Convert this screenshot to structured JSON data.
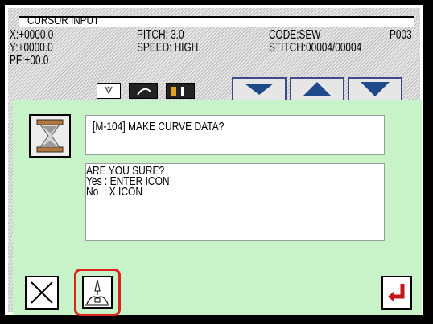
{
  "header": {
    "title": "CURSOR INPUT",
    "x": "X:+0000.0",
    "y": "Y:+0000.0",
    "pf": "PF:+00.0",
    "pitch": "PITCH: 3.0",
    "speed": "SPEED: HIGH",
    "code": "CODE:SEW",
    "pattern": "P003",
    "stitch": "STITCH:00004/00004"
  },
  "dialog": {
    "message": "[M-104] MAKE CURVE DATA?",
    "confirm_line1": "ARE YOU SURE?",
    "confirm_line2": "Yes : ENTER ICON",
    "confirm_line3": "No  : X ICON"
  },
  "buttons": {
    "cancel_icon": "x-icon",
    "curve_icon": "needle-curve-icon",
    "enter_icon": "enter-arrow-icon"
  },
  "colors": {
    "dialog_bg": "#c8f2c8",
    "highlight": "#e0201a",
    "enter_arrow": "#c01818",
    "nav_arrow": "#1e4a8c"
  }
}
